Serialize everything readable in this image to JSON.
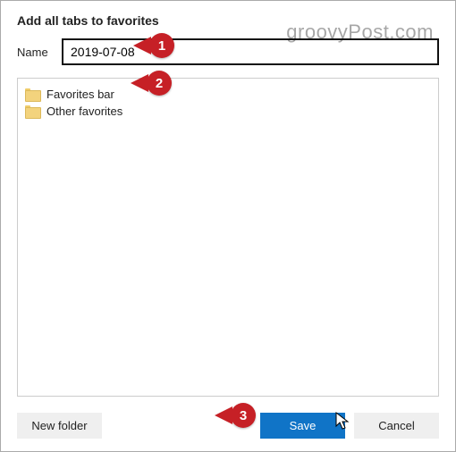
{
  "dialog": {
    "title": "Add all tabs to favorites",
    "name_label": "Name",
    "name_value": "2019-07-08",
    "folders": [
      {
        "label": "Favorites bar"
      },
      {
        "label": "Other favorites"
      }
    ],
    "buttons": {
      "new_folder": "New folder",
      "save": "Save",
      "cancel": "Cancel"
    }
  },
  "callouts": {
    "c1": "1",
    "c2": "2",
    "c3": "3"
  },
  "watermark": "groovyPost.com"
}
